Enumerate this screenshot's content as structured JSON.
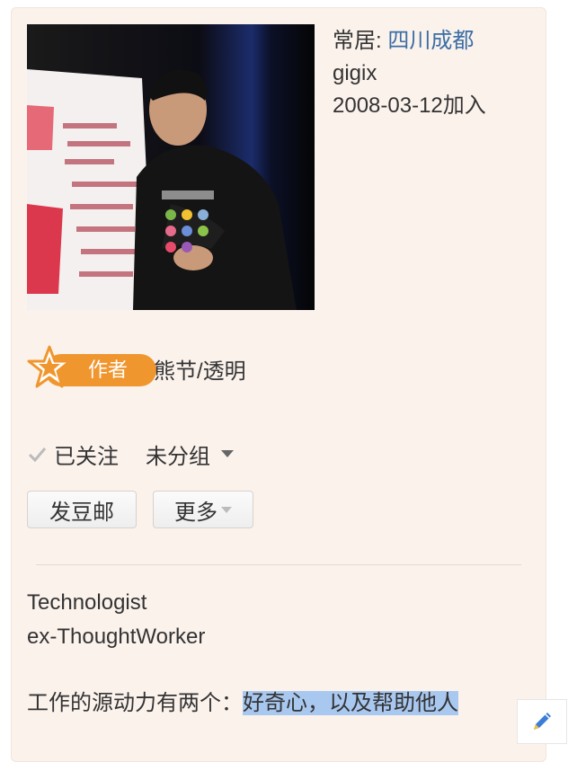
{
  "profile": {
    "residence_label": "常居:",
    "residence_value": "四川成都",
    "username": "gigix",
    "joined": "2008-03-12加入",
    "avatar_icon": "profile-photo"
  },
  "badge": {
    "label": "作者",
    "side_text": "熊节/透明",
    "color": "#f0962e"
  },
  "follow": {
    "status": "已关注",
    "group": "未分组"
  },
  "buttons": {
    "doumail": "发豆邮",
    "more": "更多"
  },
  "bio": {
    "line1": "Technologist",
    "line2": "ex-ThoughtWorker",
    "line3_prefix": "工作的源动力有两个：",
    "line3_highlight": "好奇心，以及帮助他人"
  },
  "colors": {
    "card_bg": "#fbf2ec",
    "link": "#3a6ea5",
    "highlight": "#a9c8f0"
  }
}
